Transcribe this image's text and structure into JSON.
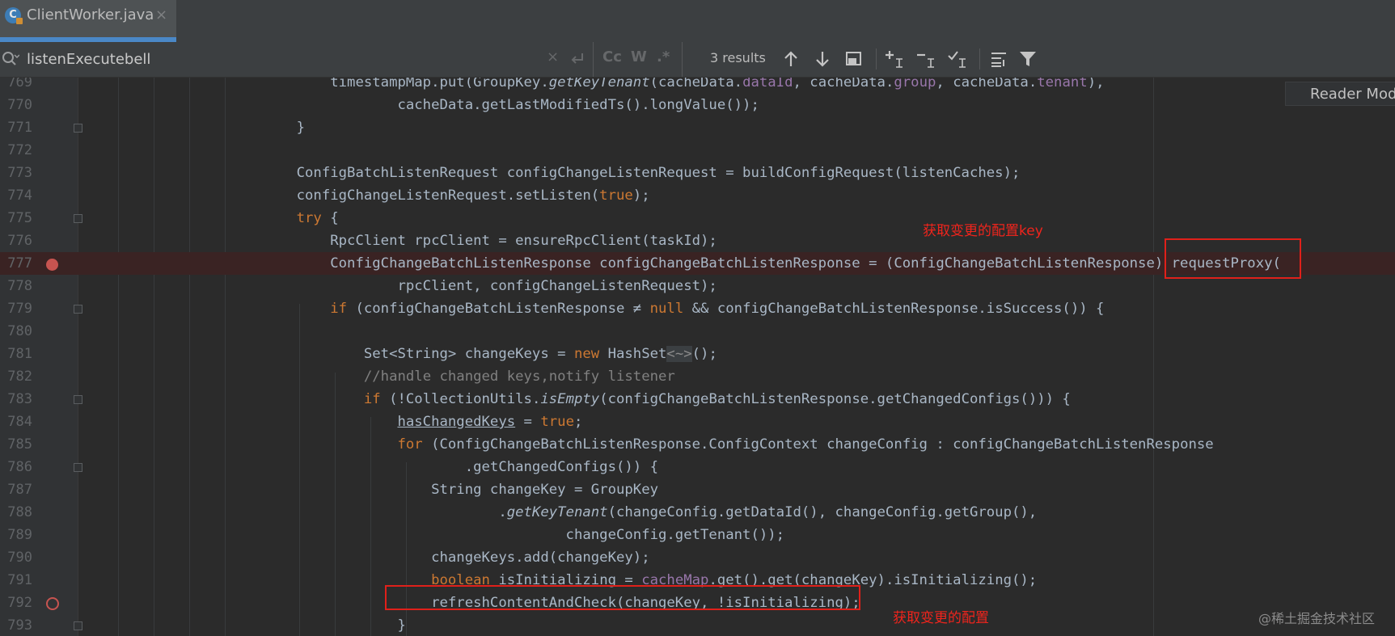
{
  "tab": {
    "title": "ClientWorker.java",
    "close": "×",
    "icon_letter": "C",
    "icon": "java-class-icon"
  },
  "search": {
    "query": "listenExecutebell",
    "results": "3 results",
    "clear": "×",
    "match_case": "Cc",
    "words": "W",
    "regex": ".*"
  },
  "reader_mode": "Reader Mode",
  "code": {
    "lines": [
      {
        "n": "769",
        "html": "        timestampMap.put(GroupKey.<span class=\"ital\">getKeyTenant</span>(cacheData.<span class=\"fld\">dataId</span>, cacheData.<span class=\"fld\">group</span>, cacheData.<span class=\"fld\">tenant</span>),"
      },
      {
        "n": "770",
        "html": "                cacheData.getLastModifiedTs().longValue());"
      },
      {
        "n": "771",
        "html": "    }"
      },
      {
        "n": "772",
        "html": ""
      },
      {
        "n": "773",
        "html": "    ConfigBatchListenRequest configChangeListenRequest = buildConfigRequest(listenCaches);"
      },
      {
        "n": "774",
        "html": "    configChangeListenRequest.setListen(<span class=\"kw\">true</span>);"
      },
      {
        "n": "775",
        "html": "    <span class=\"kw\">try</span> {"
      },
      {
        "n": "776",
        "html": "        RpcClient rpcClient = ensureRpcClient(taskId);"
      },
      {
        "n": "777",
        "html": "        ConfigChangeBatchListenResponse configChangeBatchListenResponse = (ConfigChangeBatchListenResponse) requestProxy("
      },
      {
        "n": "778",
        "html": "                rpcClient, configChangeListenRequest);"
      },
      {
        "n": "779",
        "html": "        <span class=\"kw\">if</span> (configChangeBatchListenResponse ≠ <span class=\"kw\">null</span> &amp;&amp; configChangeBatchListenResponse.isSuccess()) {"
      },
      {
        "n": "780",
        "html": ""
      },
      {
        "n": "781",
        "html": "            Set&lt;String&gt; changeKeys = <span class=\"kw\">new</span> HashSet<span class=\"hint\">&lt;~&gt;</span>();"
      },
      {
        "n": "782",
        "html": "            <span class=\"cmt\">//handle changed keys,notify listener</span>"
      },
      {
        "n": "783",
        "html": "            <span class=\"kw\">if</span> (!CollectionUtils.<span class=\"ital\">isEmpty</span>(configChangeBatchListenResponse.getChangedConfigs())) {"
      },
      {
        "n": "784",
        "html": "                <span class=\"ul\">hasChangedKeys</span> = <span class=\"kw\">true</span>;"
      },
      {
        "n": "785",
        "html": "                <span class=\"kw\">for</span> (ConfigChangeBatchListenResponse.ConfigContext changeConfig : configChangeBatchListenResponse"
      },
      {
        "n": "786",
        "html": "                        .getChangedConfigs()) {"
      },
      {
        "n": "787",
        "html": "                    String changeKey = GroupKey"
      },
      {
        "n": "788",
        "html": "                            .<span class=\"ital\">getKeyTenant</span>(changeConfig.getDataId(), changeConfig.getGroup(),"
      },
      {
        "n": "789",
        "html": "                                    changeConfig.getTenant());"
      },
      {
        "n": "790",
        "html": "                    changeKeys.add(changeKey);"
      },
      {
        "n": "791",
        "html": "                    <span class=\"kw\">boolean</span> isInitializing = <span class=\"fld\">cacheMap</span>.get().get(changeKey).isInitializing();"
      },
      {
        "n": "792",
        "html": "                    refreshContentAndCheck(changeKey, !isInitializing);"
      },
      {
        "n": "793",
        "html": "                }"
      }
    ]
  },
  "annotations": {
    "key_note": "获取变更的配置key",
    "config_note": "获取变更的配置"
  },
  "watermark": "@稀土掘金技术社区",
  "colors": {
    "highlight": "#e0201a",
    "breakpoint": "#c75450",
    "accent": "#4a88c7"
  }
}
